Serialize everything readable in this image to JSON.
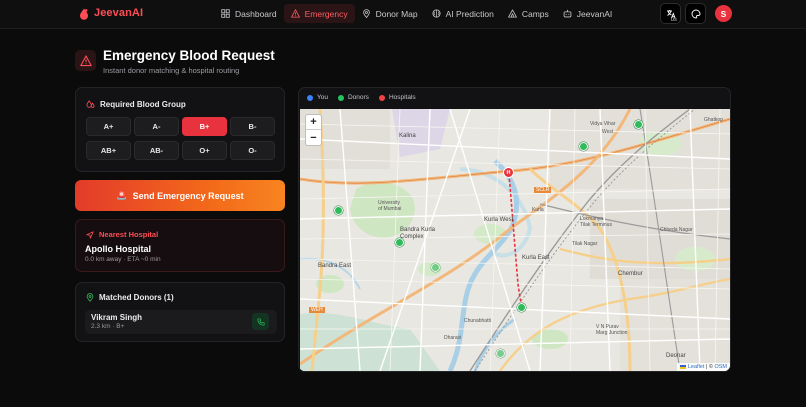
{
  "app": {
    "name": "JeevanAI"
  },
  "nav": {
    "items": [
      {
        "label": "Dashboard",
        "icon": "grid-icon",
        "active": false
      },
      {
        "label": "Emergency",
        "icon": "alert-triangle-icon",
        "active": true
      },
      {
        "label": "Donor Map",
        "icon": "map-pin-icon",
        "active": false
      },
      {
        "label": "AI Prediction",
        "icon": "brain-icon",
        "active": false
      },
      {
        "label": "Camps",
        "icon": "tent-icon",
        "active": false
      },
      {
        "label": "JeevanAI",
        "icon": "bot-icon",
        "active": false
      }
    ],
    "language_badge": "US",
    "avatar_initial": "S"
  },
  "page": {
    "title": "Emergency Blood Request",
    "subtitle": "Instant donor matching & hospital routing"
  },
  "blood_group": {
    "heading": "Required Blood Group",
    "options": [
      "A+",
      "A-",
      "B+",
      "B-",
      "AB+",
      "AB-",
      "O+",
      "O-"
    ],
    "selected": "B+"
  },
  "send_button": {
    "label": "Send Emergency Request",
    "emoji": "🚨"
  },
  "nearest_hospital": {
    "heading": "Nearest Hospital",
    "name": "Apollo Hospital",
    "meta": "0.0 km away · ETA ~0 min"
  },
  "matched_donors": {
    "heading": "Matched Donors (1)",
    "donors": [
      {
        "name": "Vikram Singh",
        "meta": "2.3 km · B+"
      }
    ]
  },
  "map": {
    "legend": [
      {
        "label": "You",
        "color": "#3b82f6"
      },
      {
        "label": "Donors",
        "color": "#22c55e"
      },
      {
        "label": "Hospitals",
        "color": "#ef4444"
      }
    ],
    "zoom_in": "+",
    "zoom_out": "−",
    "hospital_marker_letter": "H",
    "attribution_leaflet": "Leaflet",
    "attribution_sep": "| ©",
    "attribution_osm": "OSM",
    "labels": {
      "kalina": "Kalina",
      "vidya_vihar": "Vidya Vihar",
      "west": "West",
      "ghatkopar": "Ghatkop",
      "univ": "University\nof Mumbai",
      "bandra_kurla": "Bandra Kurla\nComplex",
      "bandra_east": "Bandra East",
      "kurla_west": "Kurla West",
      "kurla_east": "Kurla East",
      "kurla": "Kurla",
      "lokmanya": "Lokmanya\nTilak Terminus",
      "tilak_nagar": "Tilak Nagar",
      "chembur": "Chembur",
      "chheda": "Chheda Nagar",
      "vn_purav": "V N Purav\nMarg Junction",
      "deonar": "Deonar",
      "dharavi": "Dharavi",
      "chunabhatti": "Chunabhatti",
      "sclr": "SCLR",
      "weh": "WEH"
    }
  }
}
